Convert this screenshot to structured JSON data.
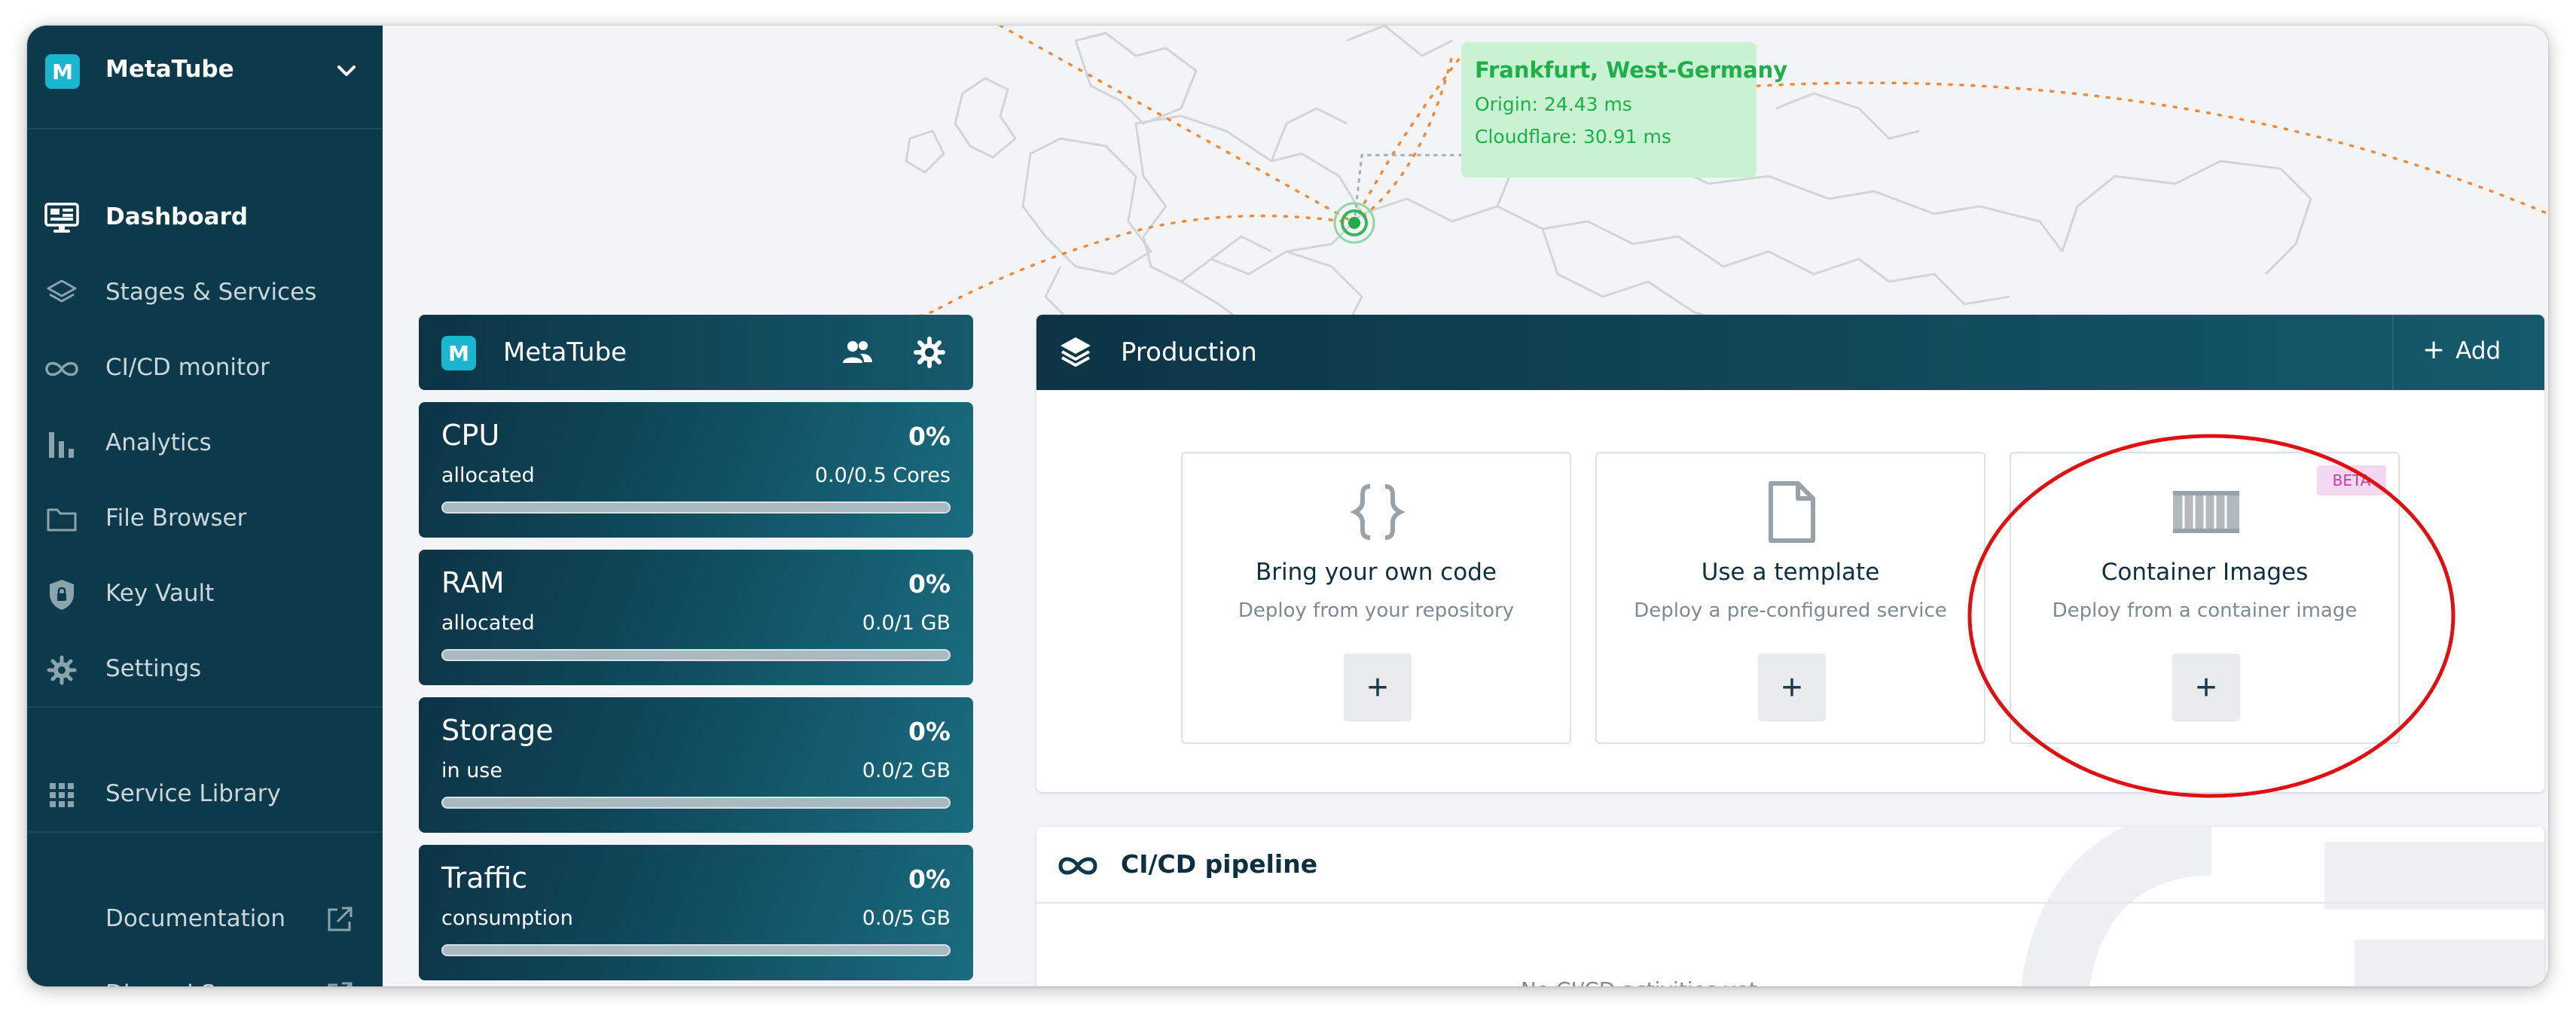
{
  "sidebar": {
    "app_logo_letter": "M",
    "app_name": "MetaTube",
    "items": [
      {
        "label": "Dashboard",
        "icon": "monitor-icon"
      },
      {
        "label": "Stages & Services",
        "icon": "layers-icon"
      },
      {
        "label": "CI/CD monitor",
        "icon": "infinity-icon"
      },
      {
        "label": "Analytics",
        "icon": "bar-chart-icon"
      },
      {
        "label": "File Browser",
        "icon": "folder-icon"
      },
      {
        "label": "Key Vault",
        "icon": "shield-icon"
      },
      {
        "label": "Settings",
        "icon": "gear-icon"
      },
      {
        "label": "Service Library",
        "icon": "grid-icon"
      }
    ],
    "links": [
      {
        "label": "Documentation",
        "icon": "external-link-icon"
      },
      {
        "label": "Discord Server",
        "icon": "external-link-icon"
      }
    ]
  },
  "map_tooltip": {
    "location": "Frankfurt, West-Germany",
    "origin": "Origin: 24.43 ms",
    "cloudflare": "Cloudflare: 30.91 ms"
  },
  "project": {
    "logo_letter": "M",
    "name": "MetaTube",
    "resources": [
      {
        "name": "CPU",
        "percent": "0%",
        "sub": "allocated",
        "value": "0.0/0.5 Cores",
        "fill_fraction": 0
      },
      {
        "name": "RAM",
        "percent": "0%",
        "sub": "allocated",
        "value": "0.0/1 GB",
        "fill_fraction": 0
      },
      {
        "name": "Storage",
        "percent": "0%",
        "sub": "in use",
        "value": "0.0/2 GB",
        "fill_fraction": 0
      },
      {
        "name": "Traffic",
        "percent": "0%",
        "sub": "consumption",
        "value": "0.0/5 GB",
        "fill_fraction": 0
      }
    ]
  },
  "production": {
    "title": "Production",
    "add_label": "Add",
    "options": [
      {
        "title": "Bring your own code",
        "subtitle": "Deploy from your repository",
        "icon": "code-braces-icon"
      },
      {
        "title": "Use a template",
        "subtitle": "Deploy a pre-configured service",
        "icon": "document-icon"
      },
      {
        "title": "Container Images",
        "subtitle": "Deploy from a container image",
        "icon": "container-icon",
        "badge": "BETA"
      }
    ],
    "plus": "+"
  },
  "cicd": {
    "title": "CI/CD pipeline",
    "empty_text": "No CI/CD activities yet"
  },
  "colors": {
    "sidebar_bg": "#0d3a4a",
    "accent": "#1ab6cf",
    "tooltip_bg": "#c8f2d1",
    "tooltip_text": "#1fae4a",
    "annotation_red": "#e01010",
    "beta_bg": "#f3d8ef",
    "beta_text": "#c53ea8"
  }
}
